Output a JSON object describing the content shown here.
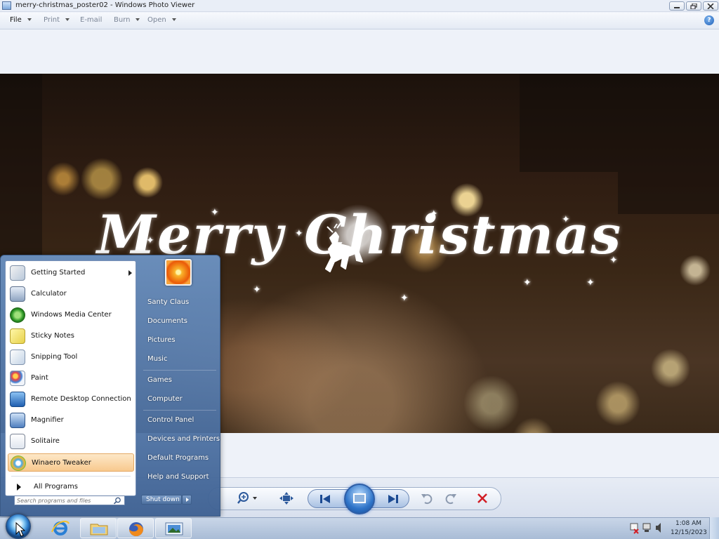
{
  "window": {
    "title": "merry-christmas_poster02 - Windows Photo Viewer"
  },
  "menu": {
    "items": [
      {
        "label": "File",
        "active": true
      },
      {
        "label": "Print",
        "active": false
      },
      {
        "label": "E-mail",
        "active": false
      },
      {
        "label": "Burn",
        "active": false
      },
      {
        "label": "Open",
        "active": false
      }
    ],
    "help_icon": "help-icon"
  },
  "photo": {
    "text": "Merry Christmas",
    "icon": "reindeer-icon"
  },
  "controls": {
    "buttons": [
      "zoom-icon",
      "fit-window-icon",
      "previous-icon",
      "slideshow-icon",
      "next-icon",
      "rotate-left-icon",
      "rotate-right-icon",
      "delete-icon"
    ]
  },
  "start_menu": {
    "programs": [
      {
        "label": "Getting Started",
        "icon": "getting-started-icon",
        "submenu": true
      },
      {
        "label": "Calculator",
        "icon": "calculator-icon"
      },
      {
        "label": "Windows Media Center",
        "icon": "media-center-icon"
      },
      {
        "label": "Sticky Notes",
        "icon": "sticky-notes-icon"
      },
      {
        "label": "Snipping Tool",
        "icon": "snipping-tool-icon"
      },
      {
        "label": "Paint",
        "icon": "paint-icon"
      },
      {
        "label": "Remote Desktop Connection",
        "icon": "remote-desktop-icon"
      },
      {
        "label": "Magnifier",
        "icon": "magnifier-icon"
      },
      {
        "label": "Solitaire",
        "icon": "solitaire-icon"
      },
      {
        "label": "Winaero Tweaker",
        "icon": "winaero-tweaker-icon",
        "highlighted": true
      }
    ],
    "all_programs": "All Programs",
    "search_placeholder": "Search programs and files",
    "places": [
      "Santy Claus",
      "Documents",
      "Pictures",
      "Music",
      "Games",
      "Computer",
      "Control Panel",
      "Devices and Printers",
      "Default Programs",
      "Help and Support"
    ],
    "shutdown_label": "Shut down"
  },
  "taskbar": {
    "pinned": [
      "internet-explorer-icon",
      "windows-explorer-icon",
      "firefox-icon",
      "photo-viewer-icon"
    ],
    "tray_icons": [
      "action-center-icon",
      "network-icon",
      "volume-icon"
    ],
    "time": "1:08 AM",
    "date": "12/15/2023"
  }
}
